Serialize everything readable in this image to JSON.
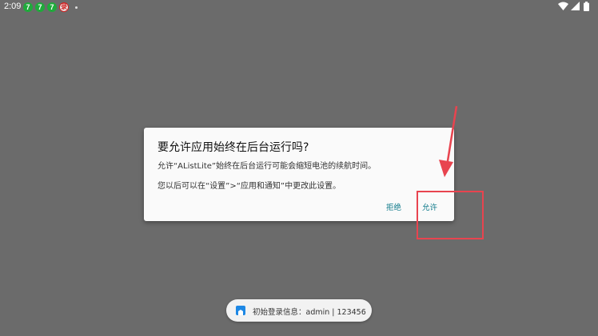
{
  "status_bar": {
    "time": "2:09",
    "notifications": [
      {
        "icon": "app-7-icon",
        "glyph": "7"
      },
      {
        "icon": "app-7-icon",
        "glyph": "7"
      },
      {
        "icon": "app-7-icon",
        "glyph": "7"
      },
      {
        "icon": "app-red-icon",
        "glyph": "录"
      }
    ],
    "system_icons": [
      "wifi-icon",
      "cellular-icon",
      "battery-icon"
    ]
  },
  "dialog": {
    "title": "要允许应用始终在后台运行吗?",
    "message1": "允许“AListLite”始终在后台运行可能会缩短电池的续航时间。",
    "message2": "您以后可以在“设置”>“应用和通知”中更改此设置。",
    "deny_label": "拒绝",
    "allow_label": "允许"
  },
  "toast": {
    "icon": "app-icon",
    "text": "初始登录信息：admin | 123456"
  },
  "colors": {
    "background": "#6b6b6b",
    "dialog_button": "#0e7a8a",
    "annotation": "#e8444f"
  }
}
